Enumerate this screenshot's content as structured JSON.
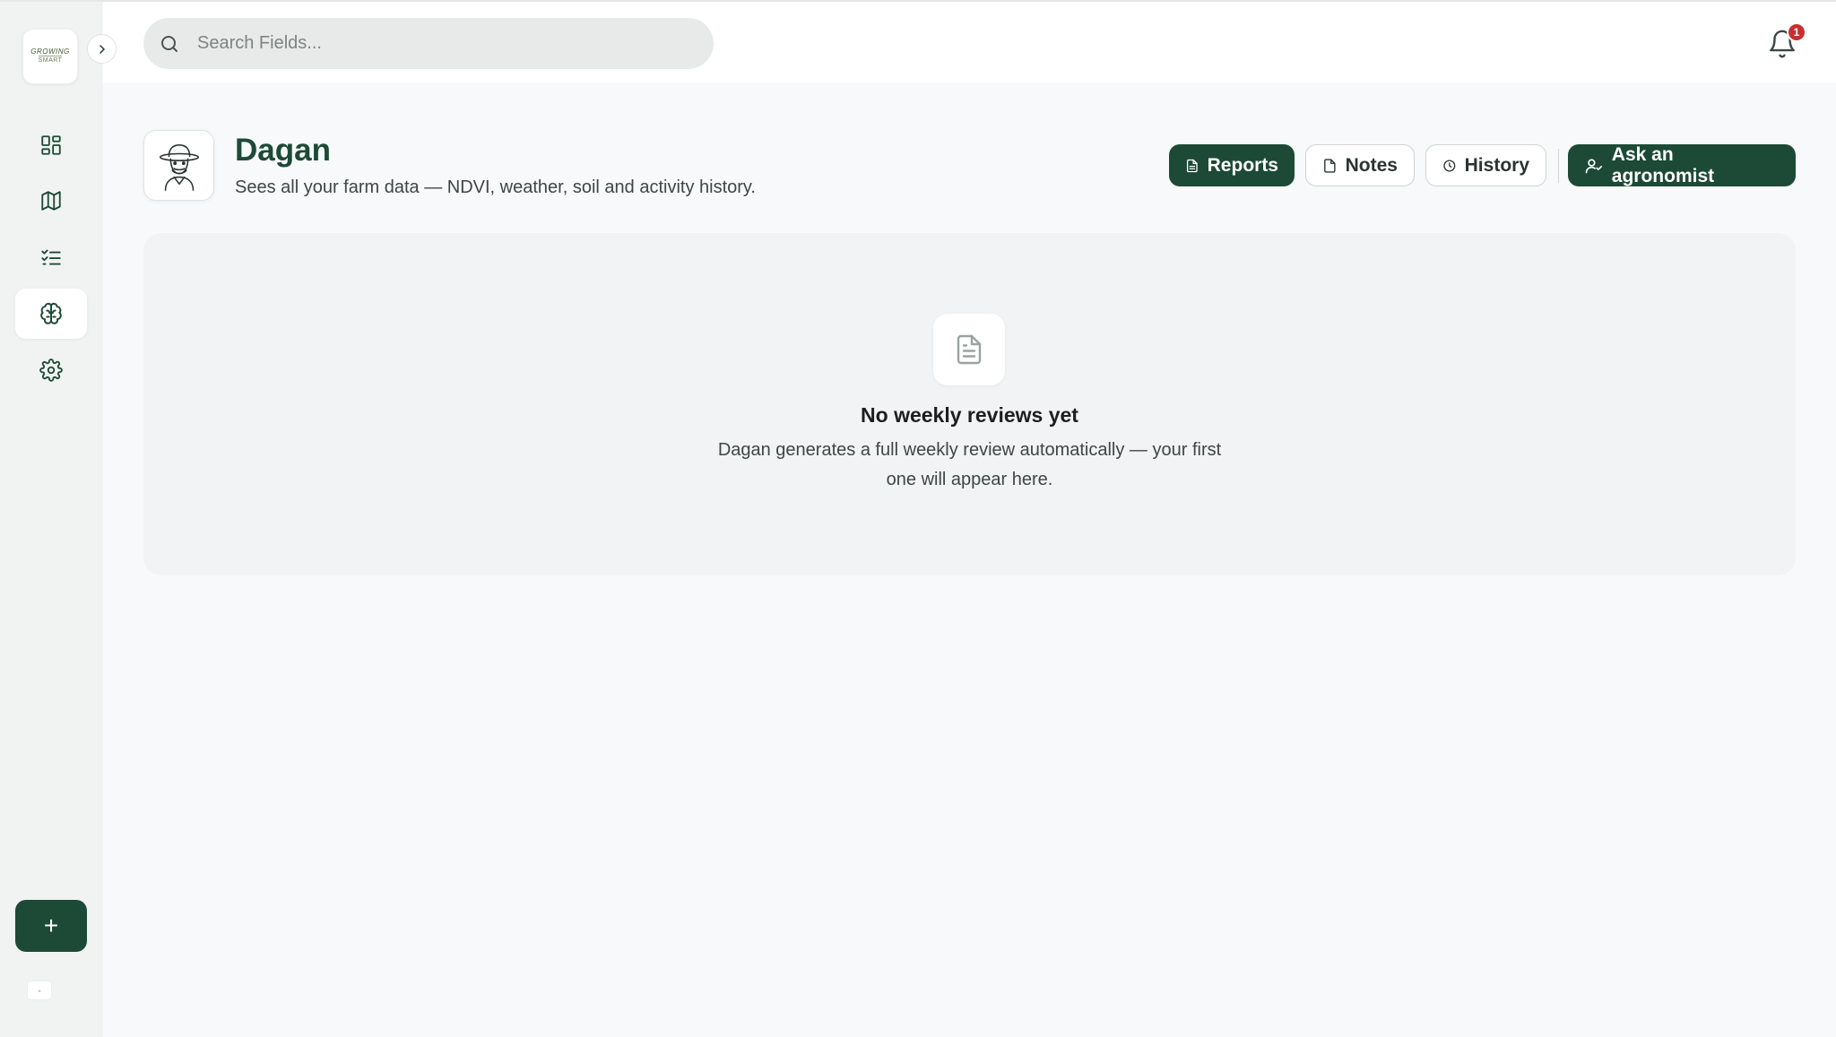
{
  "app": {
    "logo_text_top": "GROWING",
    "logo_text_bottom": "SMART"
  },
  "search": {
    "placeholder": "Search Fields..."
  },
  "notifications": {
    "count": "1"
  },
  "sidebar": {
    "items": [
      {
        "name": "dashboard",
        "icon": "grid-icon",
        "active": false
      },
      {
        "name": "map",
        "icon": "map-icon",
        "active": false
      },
      {
        "name": "tasks",
        "icon": "checklist-icon",
        "active": false
      },
      {
        "name": "dagan",
        "icon": "brain-icon",
        "active": true
      },
      {
        "name": "settings",
        "icon": "gear-icon",
        "active": false
      }
    ],
    "add_label": "+"
  },
  "header": {
    "title": "Dagan",
    "subtitle": "Sees all your farm data — NDVI, weather, soil and activity history.",
    "buttons": {
      "reports": "Reports",
      "notes": "Notes",
      "history": "History",
      "ask": "Ask an agronomist"
    }
  },
  "empty_state": {
    "title": "No weekly reviews yet",
    "description": "Dagan generates a full weekly review automatically — your first one will appear here."
  },
  "colors": {
    "brand_dark_green": "#1d4a36",
    "badge_red": "#c53030",
    "background": "#f7f9fa"
  }
}
